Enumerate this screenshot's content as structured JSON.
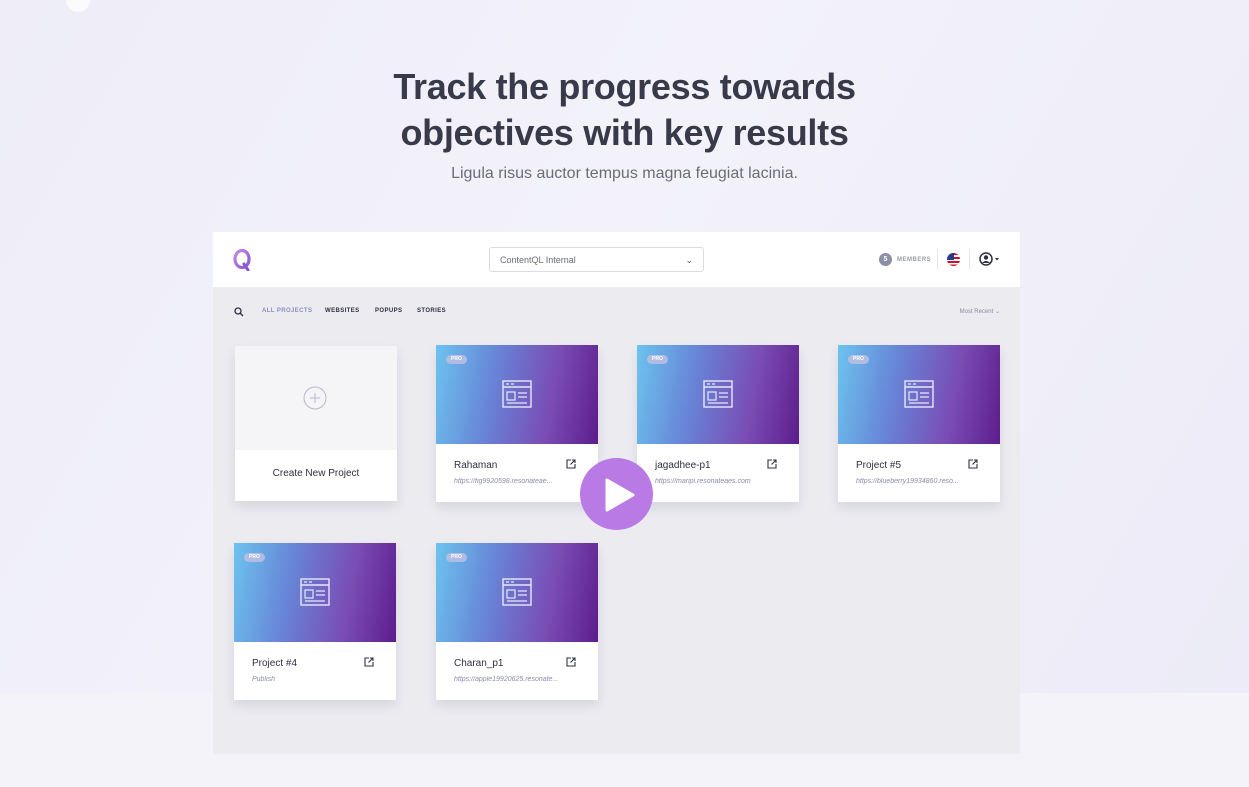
{
  "hero": {
    "title_line1": "Track the progress towards",
    "title_line2": "objectives with key results",
    "subtitle": "Ligula risus auctor tempus magna feugiat lacinia."
  },
  "app": {
    "workspace_select": "ContentQL Internal",
    "members_count": "5",
    "members_label": "MEMBERS",
    "filters": [
      "ALL PROJECTS",
      "WEBSITES",
      "POPUPS",
      "STORIES"
    ],
    "sort_label": "Most Recent",
    "create_label": "Create New Project",
    "pro_label": "PRO",
    "projects": [
      {
        "name": "Rahaman",
        "url": "https://fig9920598.resonateae..."
      },
      {
        "name": "jagadhee-p1",
        "url": "https://maripi.resonateaes.com"
      },
      {
        "name": "Project #5",
        "url": "https://blueberry19934860.reso..."
      },
      {
        "name": "Project #4",
        "url": "Publish"
      },
      {
        "name": "Charan_p1",
        "url": "https://apple19920625.resonate..."
      }
    ]
  },
  "colors": {
    "accent": "#b97ae6",
    "title": "#383a4a",
    "active_tab": "#8b8fbe"
  }
}
